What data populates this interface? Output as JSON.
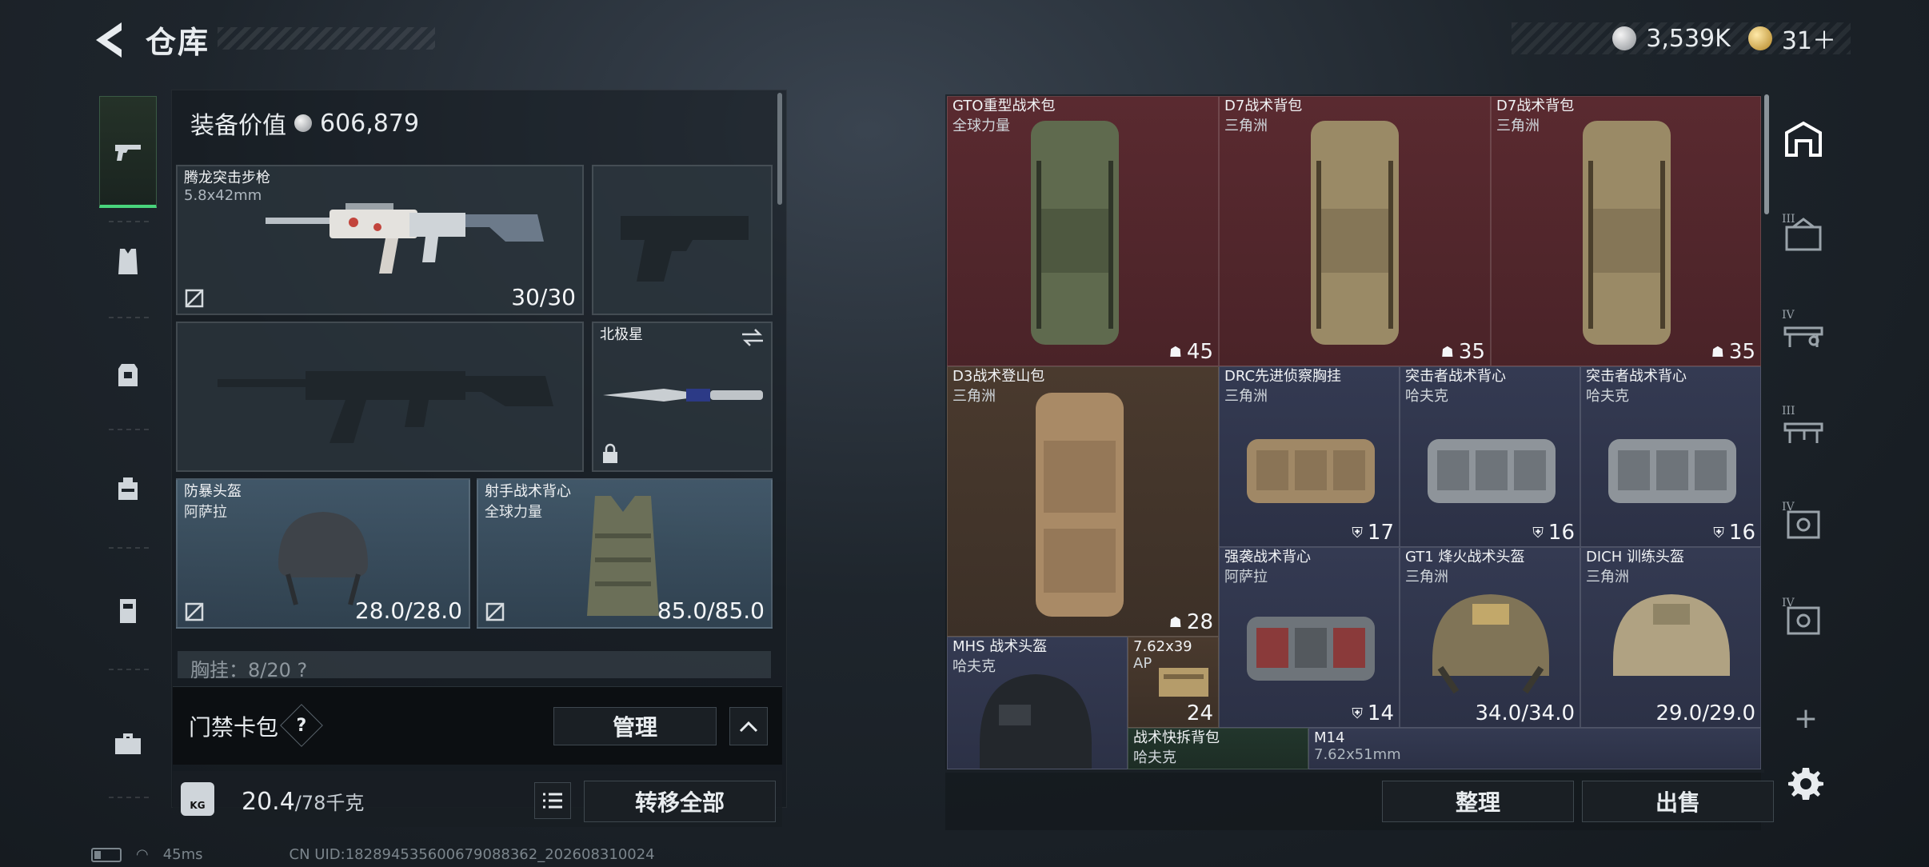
{
  "header": {
    "title": "仓库",
    "currency_silver": "3,539K",
    "currency_gold": "31＋"
  },
  "equipment": {
    "value_label": "装备价值",
    "value": "606,879",
    "primary_weapon": {
      "name": "腾龙突击步枪",
      "ammo_type": "5.8x42mm",
      "ammo": "30/30"
    },
    "melee": {
      "name": "北极星"
    },
    "helmet": {
      "name": "防暴头盔",
      "brand": "阿萨拉",
      "durability": "28.0/28.0"
    },
    "armor": {
      "name": "射手战术背心",
      "brand": "全球力量",
      "durability": "85.0/85.0"
    },
    "chest_rig": "胸挂：8/20 ?"
  },
  "card_pack": {
    "label": "门禁卡包",
    "help": "?",
    "manage_label": "管理"
  },
  "weight": {
    "current": "20.4",
    "max": "/78千克",
    "icon_label": "KG"
  },
  "actions": {
    "transfer_all": "转移全部",
    "sort": "整理",
    "sell": "出售"
  },
  "storage": {
    "items": [
      {
        "name": "GTO重型战术包",
        "brand": "全球力量",
        "count": "45"
      },
      {
        "name": "D7战术背包",
        "brand": "三角洲",
        "count": "35"
      },
      {
        "name": "D7战术背包",
        "brand": "三角洲",
        "count": "35"
      },
      {
        "name": "D3战术登山包",
        "brand": "三角洲",
        "count": "28"
      },
      {
        "name": "DRC先进侦察胸挂",
        "brand": "三角洲",
        "count": "17"
      },
      {
        "name": "突击者战术背心",
        "brand": "哈夫克",
        "count": "16"
      },
      {
        "name": "突击者战术背心",
        "brand": "哈夫克",
        "count": "16"
      },
      {
        "name": "强袭战术背心",
        "brand": "阿萨拉",
        "count": "14"
      },
      {
        "name": "GT1 烽火战术头盔",
        "brand": "三角洲",
        "count": "34.0/34.0"
      },
      {
        "name": "DICH 训练头盔",
        "brand": "三角洲",
        "count": "29.0/29.0"
      },
      {
        "name": "MHS 战术头盔",
        "brand": "哈夫克",
        "count": ""
      },
      {
        "name": "7.62x39",
        "brand": "AP",
        "count": "24"
      },
      {
        "name": "战术快拆背包",
        "brand": "哈夫克",
        "count": ""
      },
      {
        "name": "M14",
        "brand": "7.62x51mm",
        "count": ""
      }
    ]
  },
  "status": {
    "ping": "45ms",
    "uid": "CN UID:1828945356006790883​62_202608310024"
  },
  "colors": {
    "active_green": "#49d47c",
    "red_slot": "#5a2a30",
    "blue_slot": "#343a52"
  }
}
